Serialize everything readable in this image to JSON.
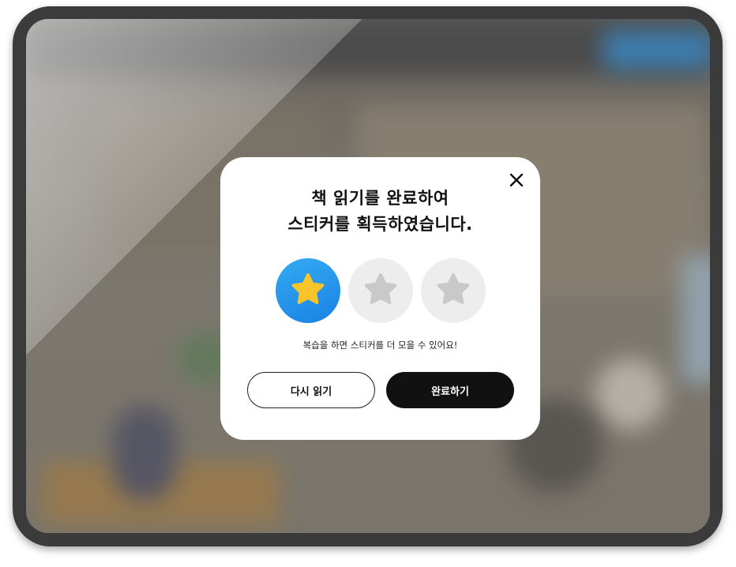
{
  "modal": {
    "title_line1": "책 읽기를 완료하여",
    "title_line2": "스티커를 획득하였습니다.",
    "hint": "복습을 하면 스티커를 더 모을 수 있어요!",
    "stickers": [
      {
        "state": "earned",
        "icon": "star-icon",
        "color": "#F7C52A"
      },
      {
        "state": "locked",
        "icon": "star-icon",
        "color": "#C9C9C9"
      },
      {
        "state": "locked",
        "icon": "star-icon",
        "color": "#C9C9C9"
      }
    ],
    "stickers_earned": 1,
    "stickers_total": 3,
    "buttons": {
      "reread_label": "다시 읽기",
      "done_label": "완료하기"
    }
  },
  "colors": {
    "earned_bg": "#1F8BE6",
    "locked_bg": "#EDEDED",
    "primary_button": "#111111"
  }
}
